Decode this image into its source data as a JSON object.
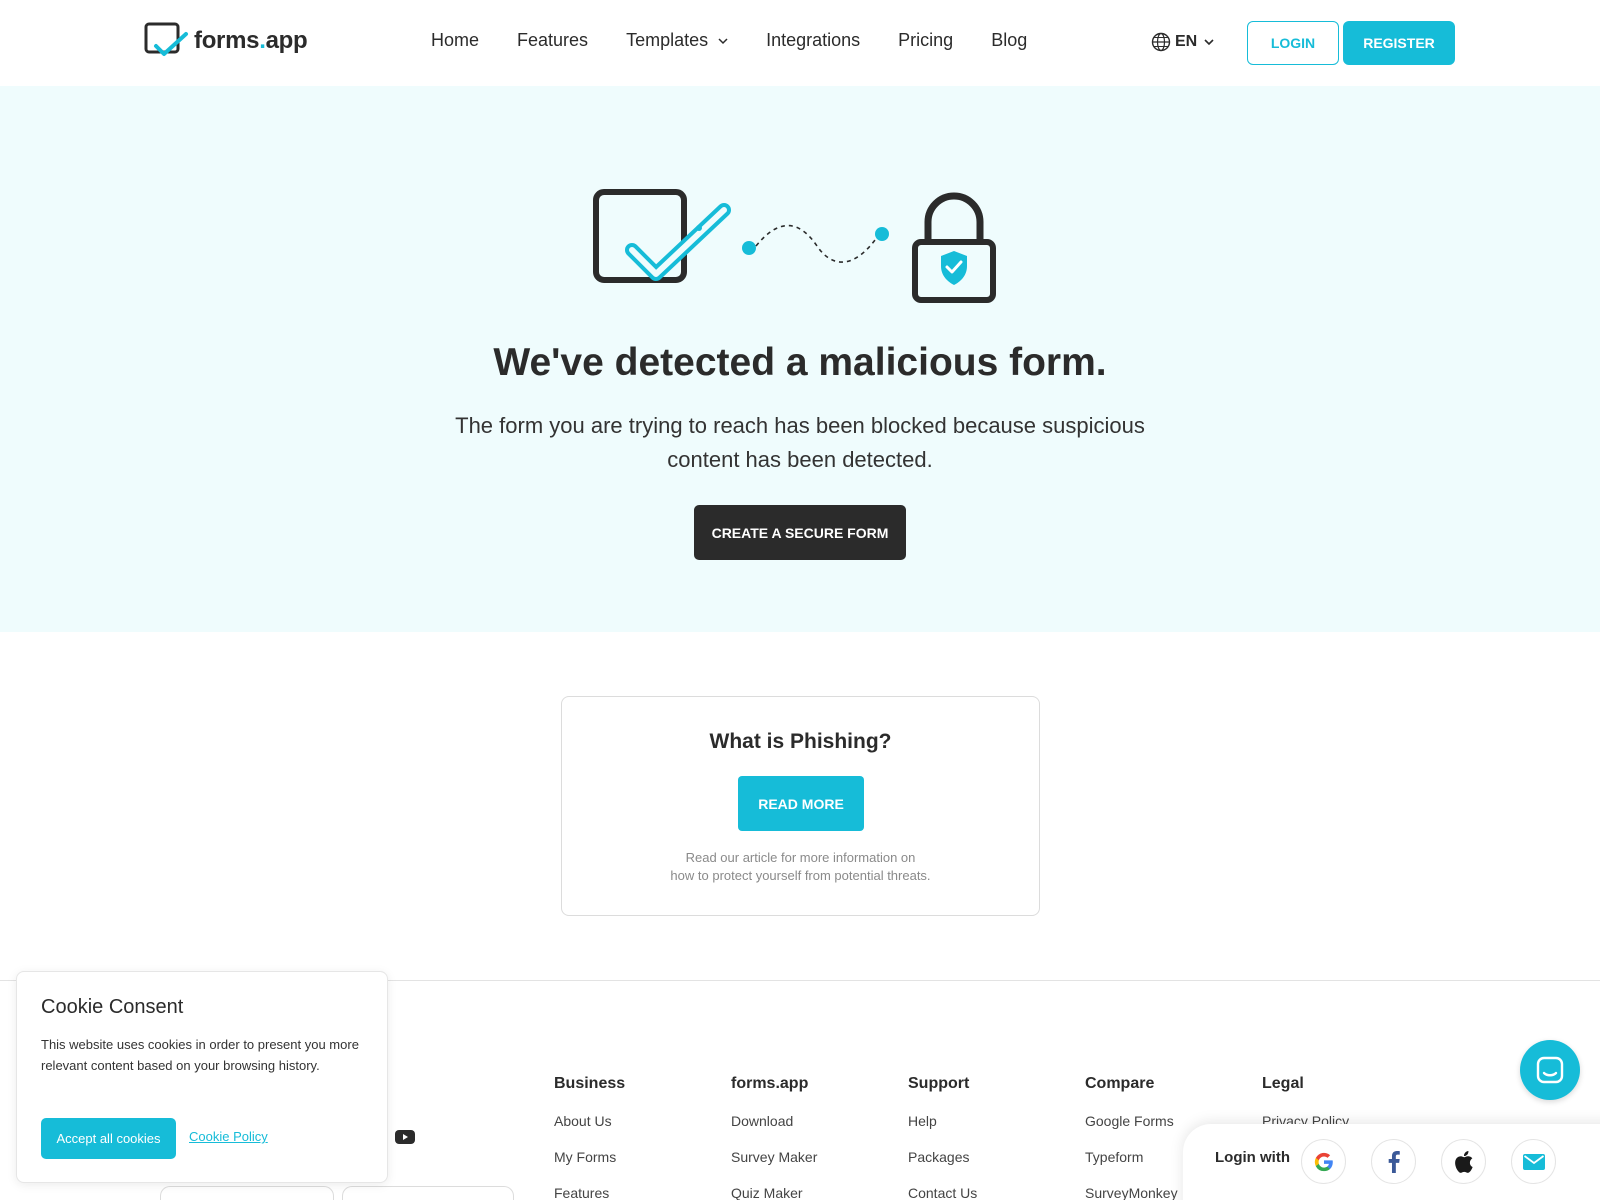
{
  "brand": {
    "name_main": "forms",
    "name_dot": ".",
    "name_tail": "app",
    "accent": "#16bcd8",
    "dark": "#2b2b2b"
  },
  "nav": {
    "items": [
      "Home",
      "Features",
      "Templates",
      "Integrations",
      "Pricing",
      "Blog"
    ],
    "language": "EN",
    "login_label": "LOGIN",
    "register_label": "REGISTER"
  },
  "hero": {
    "title": "We've detected a malicious form.",
    "subtitle": "The form you are trying to reach has been blocked because suspicious content has been detected.",
    "cta_label": "CREATE A SECURE FORM"
  },
  "phishing_card": {
    "title": "What is Phishing?",
    "button_label": "READ MORE",
    "note_line1": "Read our article for more information on",
    "note_line2": "how to protect yourself from potential threats."
  },
  "footer": {
    "columns": [
      {
        "heading": "Business",
        "links": [
          "About Us",
          "My Forms",
          "Features"
        ]
      },
      {
        "heading": "forms.app",
        "links": [
          "Download",
          "Survey Maker",
          "Quiz Maker"
        ]
      },
      {
        "heading": "Support",
        "links": [
          "Help",
          "Packages",
          "Contact Us"
        ]
      },
      {
        "heading": "Compare",
        "links": [
          "Google Forms",
          "Typeform",
          "SurveyMonkey"
        ]
      },
      {
        "heading": "Legal",
        "links": [
          "Privacy Policy"
        ]
      }
    ]
  },
  "cookie": {
    "title": "Cookie Consent",
    "text": "This website uses cookies in order to present you more relevant content based on your browsing history.",
    "accept_label": "Accept all cookies",
    "policy_label": "Cookie Policy"
  },
  "login_panel": {
    "label": "Login with",
    "providers": [
      "google-icon",
      "facebook-icon",
      "apple-icon",
      "email-icon"
    ]
  }
}
